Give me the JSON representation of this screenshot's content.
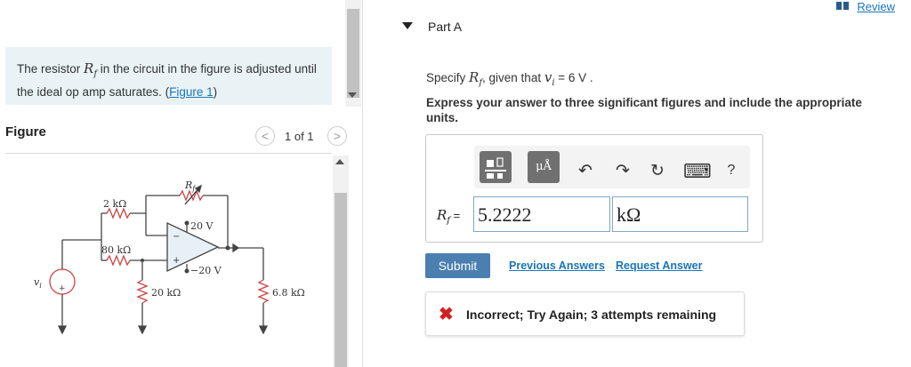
{
  "problem": {
    "text_before": "The resistor ",
    "var": "R",
    "var_sub": "f",
    "text_after": " in the circuit in the figure is adjusted until the ideal op amp saturates. (",
    "link": "Figure 1",
    "text_end": ")"
  },
  "figure": {
    "title": "Figure",
    "page_indicator": "1 of 1",
    "prev_glyph": "<",
    "next_glyph": ">",
    "labels": {
      "rf": "R",
      "rf_sub": "f",
      "r1": "2 kΩ",
      "r2": "80 kΩ",
      "r3": "20 kΩ",
      "r4": "6.8 kΩ",
      "vpos": "20 V",
      "vneg": "−20 V",
      "vi": "v",
      "vi_sub": "i",
      "plus": "+",
      "minus": "−"
    }
  },
  "header": {
    "review": "Review"
  },
  "part": {
    "title": "Part A",
    "question_before": "Specify ",
    "question_var": "R",
    "question_var_sub": "f",
    "question_mid": ", given that ",
    "question_var2": "v",
    "question_var2_sub": "i",
    "question_after": " = 6 V .",
    "instruction": "Express your answer to three significant figures and include the appropriate units."
  },
  "answer": {
    "label_var": "R",
    "label_sub": "f",
    "label_eq": " =",
    "value": "5.2222",
    "unit": "kΩ",
    "toolbar": {
      "templates_glyph": "▪▫",
      "units_glyph": "μÅ",
      "undo_glyph": "↶",
      "redo_glyph": "↷",
      "reset_glyph": "↻",
      "keyboard_glyph": "⌨",
      "help_glyph": "?"
    }
  },
  "actions": {
    "submit": "Submit",
    "previous_answers": "Previous Answers",
    "request_answer": "Request Answer"
  },
  "feedback": {
    "icon": "✖",
    "text": "Incorrect; Try Again; 3 attempts remaining"
  },
  "colors": {
    "accent": "#1a75bb",
    "submit_bg": "#4a7fb0",
    "problem_bg": "#e9f3f6",
    "error": "#d12020"
  }
}
